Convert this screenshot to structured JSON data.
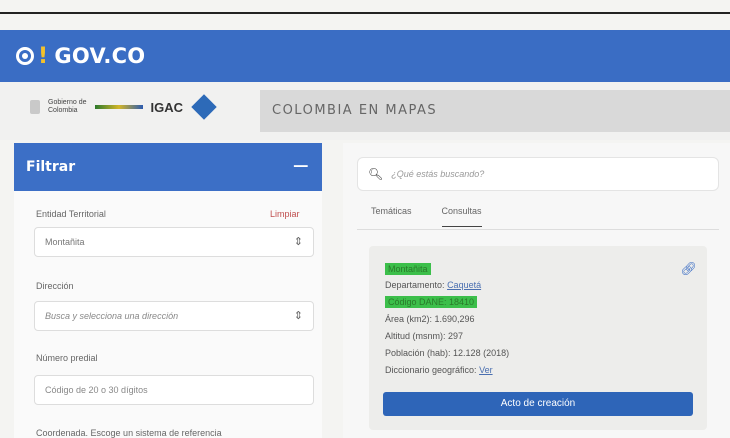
{
  "header": {
    "gov_logo_text": "GOV.CO"
  },
  "brand": {
    "gov_label_line1": "Gobierno de",
    "gov_label_line2": "Colombia",
    "igac_label": "IGAC",
    "site_title": "COLOMBIA EN MAPAS"
  },
  "filter": {
    "title": "Filtrar",
    "toggle_symbol": "−",
    "entidad_label": "Entidad Territorial",
    "clear_link": "Limpiar",
    "entidad_value": "Montañita",
    "direccion_label": "Dirección",
    "direccion_placeholder": "Busca y selecciona una dirección",
    "predial_label": "Número predial",
    "predial_placeholder": "Código de 20 o 30 dígitos",
    "coordenada_label": "Coordenada. Escoge un sistema de referencia"
  },
  "search": {
    "placeholder": "¿Qué estás buscando?"
  },
  "tabs": [
    {
      "label": "Temáticas"
    },
    {
      "label": "Consultas"
    }
  ],
  "result": {
    "name": "Montañita",
    "departamento_label": "Departamento:",
    "departamento_value": "Caquetá",
    "codigo": "Código DANE: 18410",
    "area": "Área (km2): 1.690,296",
    "altitud": "Altitud (msnm): 297",
    "poblacion": "Población (hab): 12.128 (2018)",
    "diccionario_label": "Diccionario geográfico:",
    "diccionario_link": "Ver",
    "action_button": "Acto de creación"
  },
  "colors": {
    "primary_blue": "#3a6dc4",
    "highlight_green": "#3cbf4a"
  }
}
